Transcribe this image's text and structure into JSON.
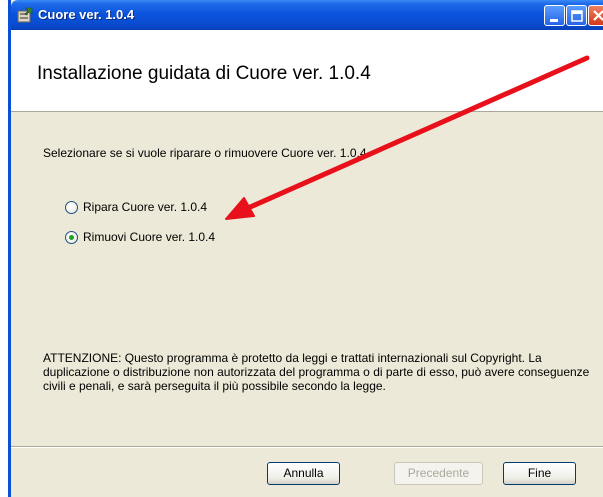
{
  "window": {
    "title": "Cuore ver. 1.0.4"
  },
  "banner": {
    "title": "Installazione guidata di Cuore ver. 1.0.4"
  },
  "main": {
    "prompt": "Selezionare se si vuole riparare o rimuovere Cuore ver. 1.0.4.",
    "options": [
      {
        "label": "Ripara Cuore ver. 1.0.4",
        "selected": false
      },
      {
        "label": "Rimuovi Cuore ver. 1.0.4",
        "selected": true
      }
    ],
    "warning": "ATTENZIONE: Questo programma è protetto da leggi e trattati internazionali sul Copyright. La duplicazione o distribuzione non autorizzata del programma o di parte di esso, può avere conseguenze civili e penali, e sarà perseguita il più possibile secondo la legge."
  },
  "buttons": {
    "cancel": "Annulla",
    "back": "Precedente",
    "finish": "Fine"
  },
  "colors": {
    "titlebar": "#0a4cd0",
    "annotation_arrow": "#e8101a",
    "radio_dot": "#21a121"
  },
  "icons": {
    "title_icon": "installer-icon",
    "annotation": "red-arrow-annotation"
  }
}
